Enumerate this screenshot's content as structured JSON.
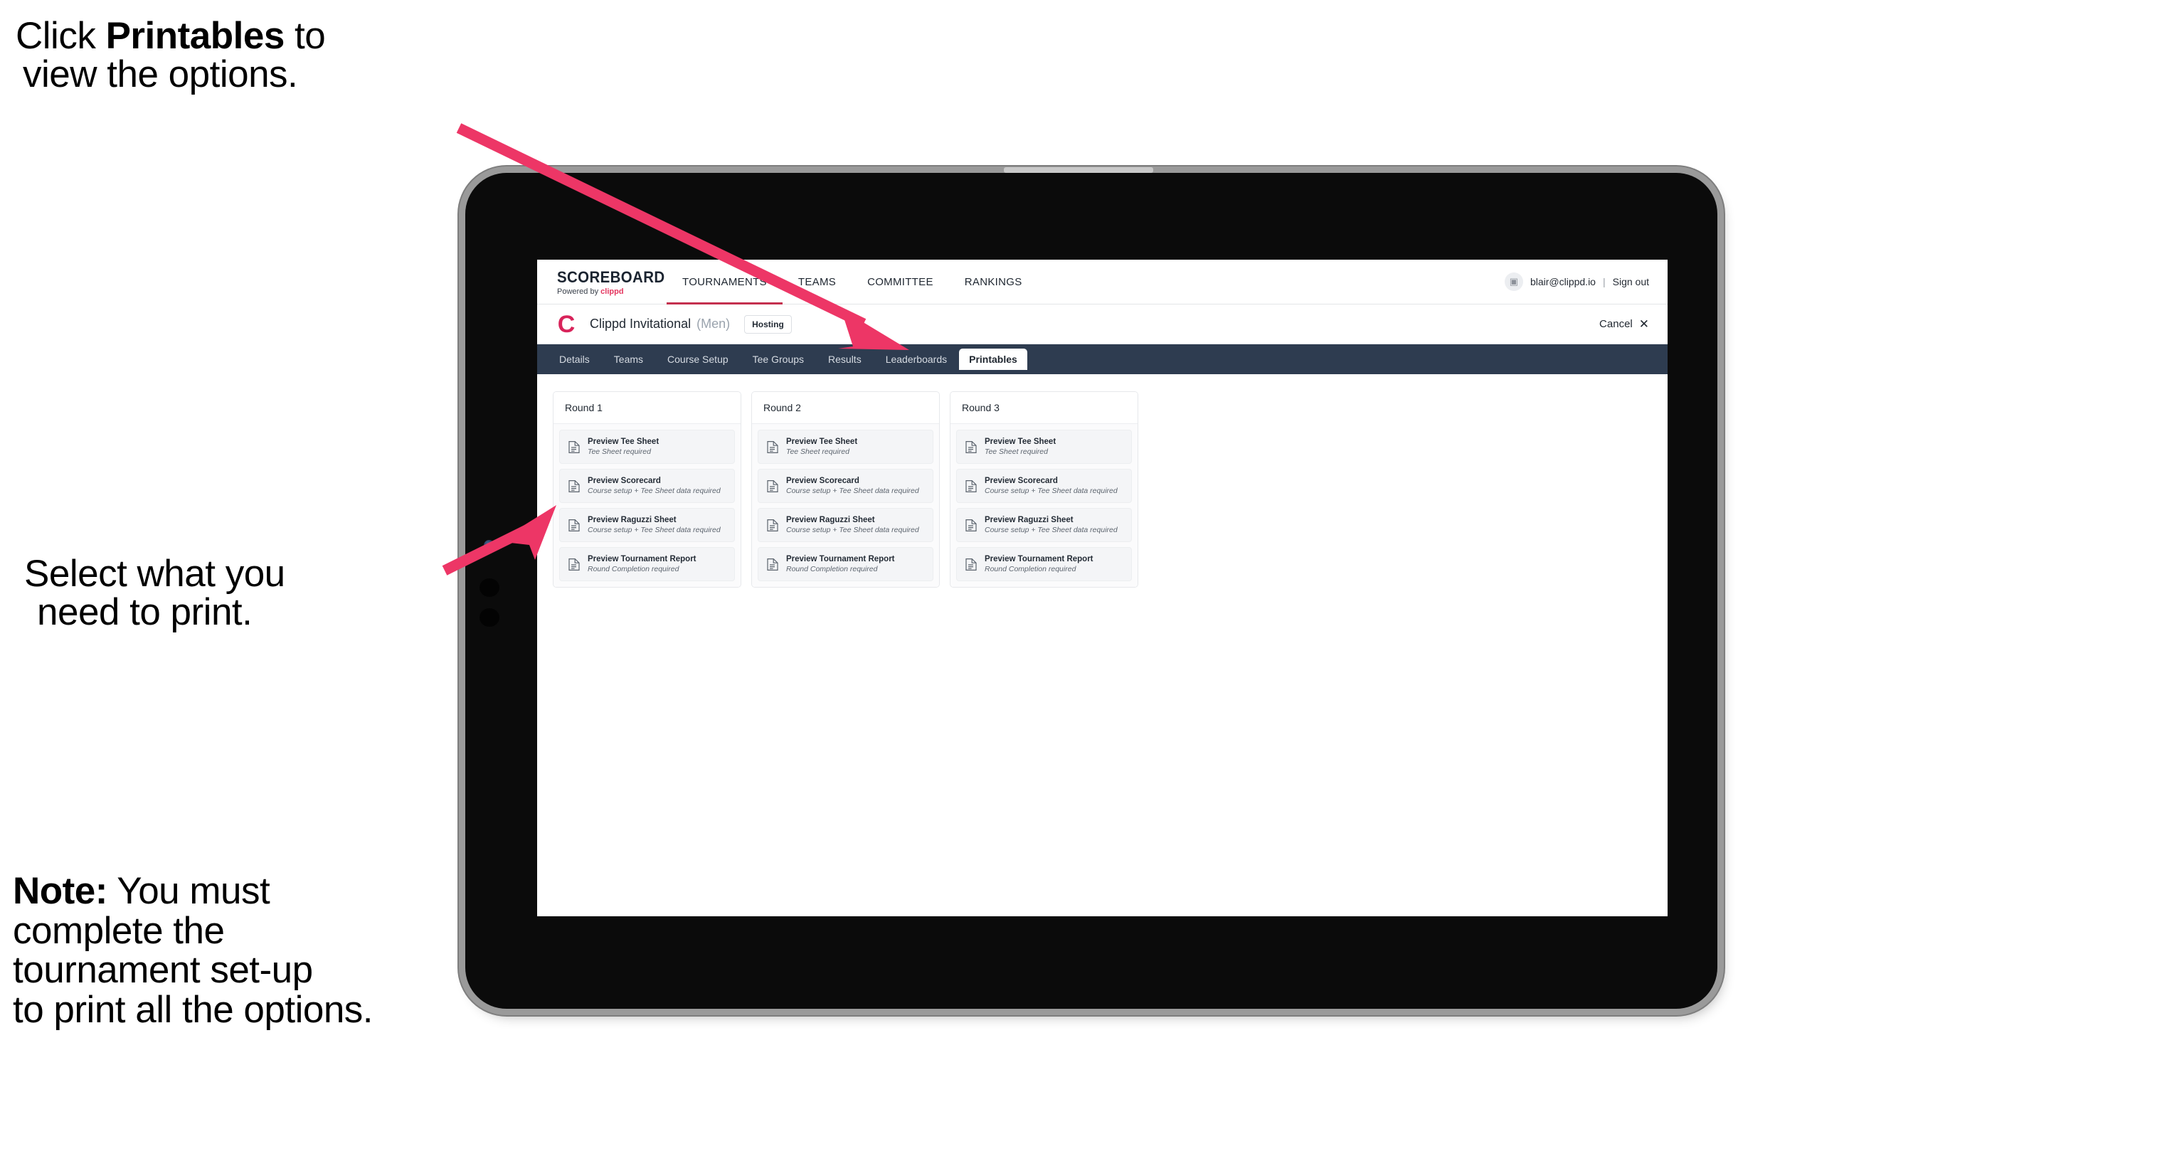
{
  "annotations": [
    {
      "id": "annot-1",
      "line1_pre": "Click ",
      "line1_bold": "Printables",
      "line1_post": " to",
      "line2": "view the options."
    },
    {
      "id": "annot-2",
      "line1": "Select what you",
      "line2": "need to print."
    },
    {
      "id": "annot-3",
      "bold": "Note:",
      "rest": " You must",
      "line2": "complete the",
      "line3": "tournament set-up",
      "line4": "to print all the options."
    }
  ],
  "colors": {
    "arrow_pink": "#ed3666",
    "navy_tabstrip": "#2e3c50",
    "brand_pink": "#e4365f",
    "clippd_red": "#d8235a",
    "active_underline": "#c4304f"
  },
  "app": {
    "brand": {
      "name": "SCOREBOARD",
      "powered_prefix": "Powered by ",
      "powered_brand": "clippd"
    },
    "topnav": [
      {
        "label": "TOURNAMENTS",
        "active": true
      },
      {
        "label": "TEAMS",
        "active": false
      },
      {
        "label": "COMMITTEE",
        "active": false
      },
      {
        "label": "RANKINGS",
        "active": false
      }
    ],
    "account": {
      "avatar_glyph": "▣",
      "email": "blair@clippd.io",
      "separator": "|",
      "signout": "Sign out"
    },
    "tournament": {
      "logo_glyph": "C",
      "name": "Clippd Invitational",
      "gender": "(Men)",
      "badge": "Hosting",
      "cancel_label": "Cancel",
      "cancel_icon": "✕"
    },
    "tabs": [
      {
        "label": "Details",
        "active": false
      },
      {
        "label": "Teams",
        "active": false
      },
      {
        "label": "Course Setup",
        "active": false
      },
      {
        "label": "Tee Groups",
        "active": false
      },
      {
        "label": "Results",
        "active": false
      },
      {
        "label": "Leaderboards",
        "active": false
      },
      {
        "label": "Printables",
        "active": true
      }
    ],
    "rounds": [
      {
        "header": "Round 1",
        "items": [
          {
            "title": "Preview Tee Sheet",
            "sub": "Tee Sheet required"
          },
          {
            "title": "Preview Scorecard",
            "sub": "Course setup + Tee Sheet data required"
          },
          {
            "title": "Preview Raguzzi Sheet",
            "sub": "Course setup + Tee Sheet data required"
          },
          {
            "title": "Preview Tournament Report",
            "sub": "Round Completion required"
          }
        ]
      },
      {
        "header": "Round 2",
        "items": [
          {
            "title": "Preview Tee Sheet",
            "sub": "Tee Sheet required"
          },
          {
            "title": "Preview Scorecard",
            "sub": "Course setup + Tee Sheet data required"
          },
          {
            "title": "Preview Raguzzi Sheet",
            "sub": "Course setup + Tee Sheet data required"
          },
          {
            "title": "Preview Tournament Report",
            "sub": "Round Completion required"
          }
        ]
      },
      {
        "header": "Round 3",
        "items": [
          {
            "title": "Preview Tee Sheet",
            "sub": "Tee Sheet required"
          },
          {
            "title": "Preview Scorecard",
            "sub": "Course setup + Tee Sheet data required"
          },
          {
            "title": "Preview Raguzzi Sheet",
            "sub": "Course setup + Tee Sheet data required"
          },
          {
            "title": "Preview Tournament Report",
            "sub": "Round Completion required"
          }
        ]
      }
    ]
  }
}
